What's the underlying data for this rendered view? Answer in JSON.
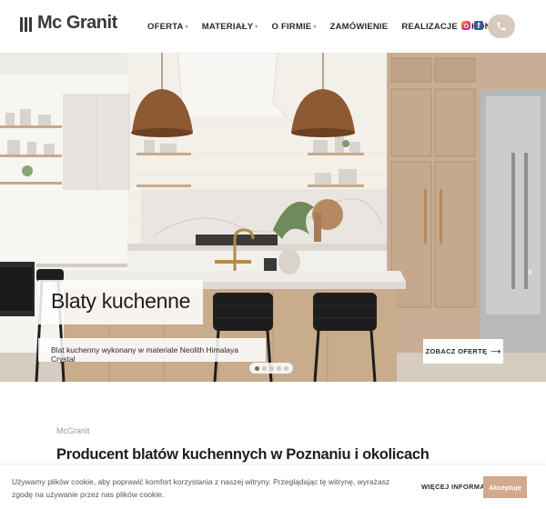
{
  "header": {
    "logo_text": "Mc Granit",
    "nav": [
      {
        "label": "OFERTA",
        "has_dropdown": true
      },
      {
        "label": "MATERIAŁY",
        "has_dropdown": true
      },
      {
        "label": "O FIRMIE",
        "has_dropdown": true
      },
      {
        "label": "ZAMÓWIENIE",
        "has_dropdown": false
      },
      {
        "label": "REALIZACJE",
        "has_dropdown": false
      },
      {
        "label": "KONTAKT",
        "has_dropdown": false
      }
    ],
    "social_icons": [
      "instagram-icon",
      "facebook-icon"
    ],
    "phone_icon": "phone-icon",
    "accent_color": "#d8c9bd"
  },
  "hero": {
    "title": "Blaty kuchenne",
    "caption": "Blat kuchenny wykonany w materiale Neolith Himalaya Crystal",
    "cta_label": "ZOBACZ OFERTĘ",
    "cta_icon": "arrow-right-icon",
    "slides_total": 5,
    "active_slide": 1
  },
  "main": {
    "eyebrow": "McGranit",
    "heading": "Producent blatów kuchennych w Poznaniu i okolicach"
  },
  "cookie": {
    "text": "Używamy plików cookie, aby poprawić komfort korzystania z naszej witryny. Przeglądając tę witrynę, wyrażasz zgodę na używanie przez nas plików cookie.",
    "more_label": "WIĘCEJ INFORMACJI",
    "accept_label": "Akceptuję",
    "accept_color": "#d2a98a"
  }
}
